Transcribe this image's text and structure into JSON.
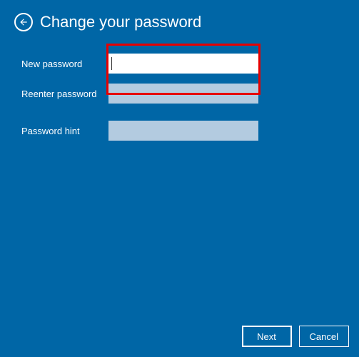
{
  "header": {
    "title": "Change your password"
  },
  "form": {
    "newPassword": {
      "label": "New password",
      "value": ""
    },
    "reenterPassword": {
      "label": "Reenter password",
      "value": ""
    },
    "passwordHint": {
      "label": "Password hint",
      "value": ""
    }
  },
  "footer": {
    "nextLabel": "Next",
    "cancelLabel": "Cancel"
  }
}
